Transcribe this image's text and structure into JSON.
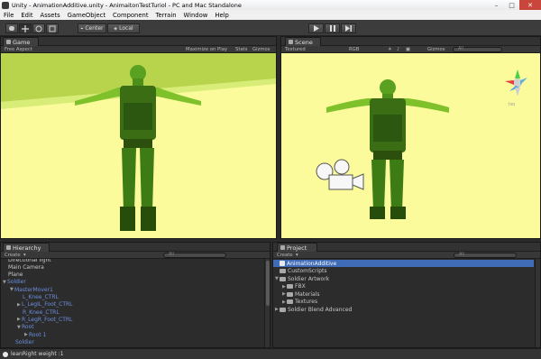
{
  "window": {
    "title": "Unity - AnimationAdditive.unity - AnimaitonTestTuriol - PC and Mac Standalone"
  },
  "menu": [
    "File",
    "Edit",
    "Assets",
    "GameObject",
    "Component",
    "Terrain",
    "Window",
    "Help"
  ],
  "toolbar": {
    "pivot_label": "Center",
    "space_label": "Local"
  },
  "game_view": {
    "tab_label": "Game",
    "aspect_label": "Free Aspect",
    "maximize_label": "Maximize on Play",
    "stats_label": "Stats",
    "gizmos_label": "Gizmos"
  },
  "scene_view": {
    "tab_label": "Scene",
    "render_mode": "Textured",
    "color_mode": "RGB",
    "gizmos_label": "Gizmos",
    "search_placeholder": "All",
    "persp_label": "Iso"
  },
  "hierarchy": {
    "tab_label": "Hierarchy",
    "create_label": "Create",
    "search_placeholder": "All",
    "items": [
      {
        "label": "Directional light",
        "depth": 0,
        "arrow": "",
        "color": "normal"
      },
      {
        "label": "Main Camera",
        "depth": 0,
        "arrow": "",
        "color": "normal"
      },
      {
        "label": "Plane",
        "depth": 0,
        "arrow": "",
        "color": "normal"
      },
      {
        "label": "Soldier",
        "depth": 0,
        "arrow": "▼",
        "color": "blue"
      },
      {
        "label": "MasterMover1",
        "depth": 1,
        "arrow": "▼",
        "color": "blue"
      },
      {
        "label": "L_Knee_CTRL",
        "depth": 2,
        "arrow": "",
        "color": "blue"
      },
      {
        "label": "L_LegIL_Foot_CTRL",
        "depth": 2,
        "arrow": "▶",
        "color": "blue"
      },
      {
        "label": "R_Knee_CTRL",
        "depth": 2,
        "arrow": "",
        "color": "blue"
      },
      {
        "label": "R_LegR_Foot_CTRL",
        "depth": 2,
        "arrow": "▶",
        "color": "blue"
      },
      {
        "label": "Root",
        "depth": 2,
        "arrow": "▼",
        "color": "blue"
      },
      {
        "label": "Root 1",
        "depth": 3,
        "arrow": "▶",
        "color": "blue"
      },
      {
        "label": "Soldier",
        "depth": 1,
        "arrow": "",
        "color": "blue"
      }
    ]
  },
  "project": {
    "tab_label": "Project",
    "create_label": "Create",
    "search_placeholder": "All",
    "items": [
      {
        "label": "AnimationAdditive",
        "depth": 0,
        "arrow": "",
        "selected": true,
        "icon": "unity-scene-icon"
      },
      {
        "label": "CustomScripts",
        "depth": 0,
        "arrow": "",
        "selected": false,
        "icon": "folder-icon"
      },
      {
        "label": "Soldier Artwork",
        "depth": 0,
        "arrow": "▼",
        "selected": false,
        "icon": "folder-icon"
      },
      {
        "label": "FBX",
        "depth": 1,
        "arrow": "▶",
        "selected": false,
        "icon": "folder-icon"
      },
      {
        "label": "Materials",
        "depth": 1,
        "arrow": "▶",
        "selected": false,
        "icon": "folder-icon"
      },
      {
        "label": "Textures",
        "depth": 1,
        "arrow": "▶",
        "selected": false,
        "icon": "folder-icon"
      },
      {
        "label": "Soldier Blend Advanced",
        "depth": 0,
        "arrow": "▶",
        "selected": false,
        "icon": "folder-icon"
      }
    ]
  },
  "status": {
    "message": "leanRight weight :1"
  },
  "colors": {
    "viewport_bg": "#fbfb9b",
    "floor": "#d9f27c",
    "soldier_green": "#4a8a1c",
    "selection": "#3f6bb7",
    "hierarchy_blue": "#6b8fde"
  }
}
